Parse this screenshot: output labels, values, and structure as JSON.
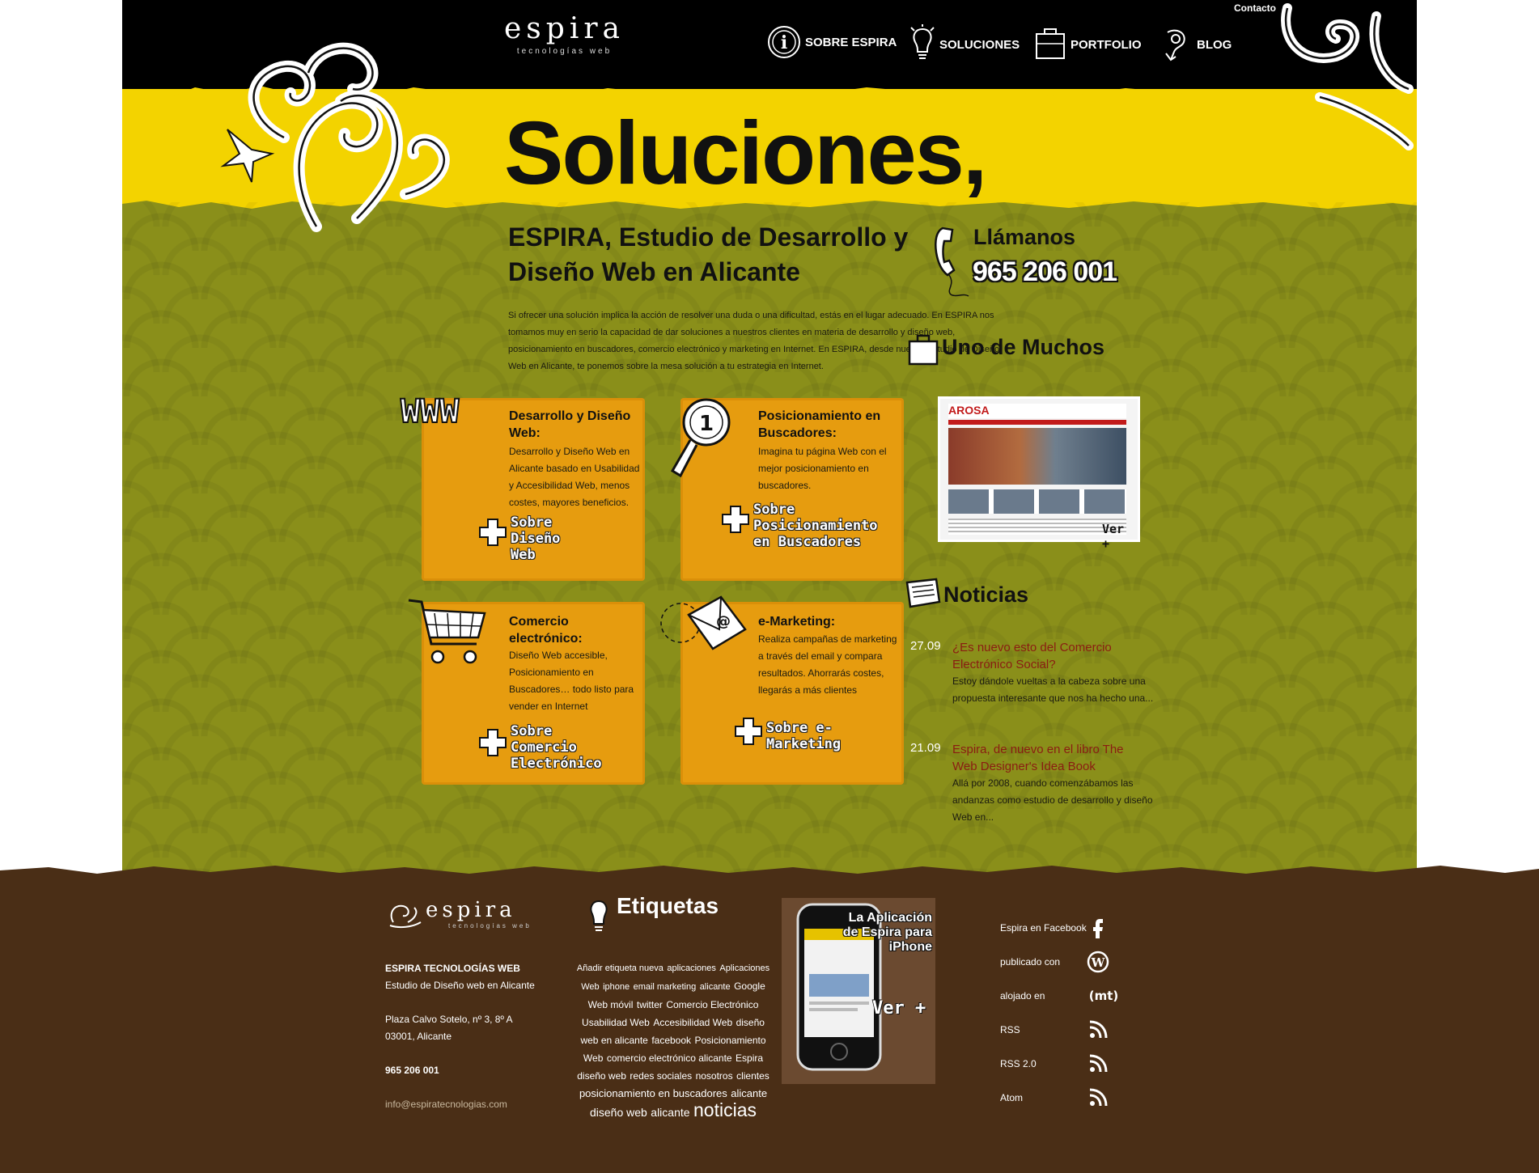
{
  "header": {
    "logo_name": "espira",
    "logo_tag": "tecnologías web",
    "contact_link": "Contacto",
    "nav": [
      {
        "label": "SOBRE ESPIRA",
        "icon": "info-icon"
      },
      {
        "label": "SOLUCIONES",
        "icon": "lightbulb-icon"
      },
      {
        "label": "PORTFOLIO",
        "icon": "briefcase-icon"
      },
      {
        "label": "BLOG",
        "icon": "megaphone-icon"
      }
    ]
  },
  "hero": {
    "title": "Soluciones,"
  },
  "intro": {
    "title_part1": "ESPIRA,",
    "title_part2": " Estudio de ",
    "title_part3": "Desarrollo y Diseño Web",
    "title_part4": " en Alicante",
    "text": "Si ofrecer una solución implica la acción de resolver una duda o una dificultad, estás en el lugar adecuado. En ESPIRA nos tomamos muy en serio la capacidad de dar soluciones a nuestros clientes en materia de desarrollo y diseño web, posicionamiento en buscadores, comercio electrónico y marketing en Internet. En ESPIRA, desde nuestro estudio de Diseño Web en Alicante, te ponemos sobre la mesa solución a tu estrategia en Internet."
  },
  "services": [
    {
      "title": "Desarrollo y Diseño Web:",
      "desc": "Desarrollo y Diseño Web en Alicante basado en Usabilidad y Accesibilidad Web, menos costes, mayores beneficios.",
      "more": "Sobre Diseño Web",
      "badge": "WWW",
      "icon": "www-icon"
    },
    {
      "title": "Posicionamiento en Buscadores:",
      "desc": "Imagina tu página Web con el mejor posicionamiento en buscadores.",
      "more": "Sobre Posicionamiento en Buscadores",
      "icon": "magnifier-icon"
    },
    {
      "title": "Comercio electrónico:",
      "desc": "Diseño Web accesible, Posicionamiento en Buscadores… todo listo para vender en Internet",
      "more": "Sobre Comercio Electrónico",
      "icon": "shopping-cart-icon"
    },
    {
      "title": "e-Marketing:",
      "desc": "Realiza campañas de marketing a través del email y compara resultados. Ahorrarás costes, llegarás a más clientes",
      "more": "Sobre e-Marketing",
      "icon": "envelope-icon"
    }
  ],
  "sidebar": {
    "call_heading": "Llámanos",
    "phone": "965 206 001",
    "portfolio_heading": "Uno de Muchos",
    "portfolio_site": "AROSA",
    "portfolio_more": "Ver +",
    "news_heading": "Noticias",
    "news": [
      {
        "date": "27.09",
        "title": "¿Es nuevo esto del Comercio Electrónico Social?",
        "excerpt": "Estoy dándole vueltas a la cabeza sobre una propuesta interesante que nos ha hecho una..."
      },
      {
        "date": "21.09",
        "title": "Espira, de nuevo en el libro The Web Designer's Idea Book",
        "excerpt": "Allá por 2008, cuando comenzábamos las andanzas como estudio de desarrollo y diseño Web en..."
      }
    ]
  },
  "footer": {
    "logo_name": "espira",
    "logo_tag": "tecnologías web",
    "company": "ESPIRA TECNOLOGÍAS WEB",
    "tagline": "Estudio de Diseño web en Alicante",
    "address1": "Plaza Calvo Sotelo, nº 3, 8º A",
    "address2": "03001, Alicante",
    "phone": "965 206 001",
    "email": "info@espiratecnologias.com",
    "tags_heading": "Etiquetas",
    "tags": [
      {
        "t": "Añadir etiqueta nueva",
        "s": 11
      },
      {
        "t": "aplicaciones",
        "s": 11
      },
      {
        "t": "Aplicaciones Web",
        "s": 11
      },
      {
        "t": "iphone",
        "s": 11
      },
      {
        "t": "email marketing",
        "s": 11
      },
      {
        "t": "alicante",
        "s": 11
      },
      {
        "t": "Google",
        "s": 12
      },
      {
        "t": "Web móvil",
        "s": 12
      },
      {
        "t": "twitter",
        "s": 12
      },
      {
        "t": "Comercio Electrónico",
        "s": 12
      },
      {
        "t": "Usabilidad Web",
        "s": 12
      },
      {
        "t": "Accesibilidad Web",
        "s": 12
      },
      {
        "t": "diseño web en alicante",
        "s": 12
      },
      {
        "t": "facebook",
        "s": 12
      },
      {
        "t": "Posicionamiento Web",
        "s": 12
      },
      {
        "t": "comercio electrónico alicante",
        "s": 12
      },
      {
        "t": "Espira",
        "s": 12
      },
      {
        "t": "diseño web",
        "s": 12
      },
      {
        "t": "redes sociales",
        "s": 12
      },
      {
        "t": "nosotros",
        "s": 12
      },
      {
        "t": "clientes",
        "s": 12
      },
      {
        "t": "posicionamiento en buscadores",
        "s": 13
      },
      {
        "t": "alicante",
        "s": 13
      },
      {
        "t": "diseño web",
        "s": 14
      },
      {
        "t": "alicante",
        "s": 14
      },
      {
        "t": "noticias",
        "s": 23
      }
    ],
    "iphone_title": "La Aplicación de Espira para iPhone",
    "iphone_more": "Ver +",
    "social": [
      {
        "label": "Espira en Facebook",
        "icon": "facebook-icon"
      },
      {
        "label": "publicado con",
        "icon": "wordpress-icon"
      },
      {
        "label": "alojado en",
        "icon": "mediatemple-icon"
      },
      {
        "label": "RSS",
        "icon": "rss-icon"
      },
      {
        "label": "RSS 2.0",
        "icon": "rss-icon"
      },
      {
        "label": "Atom",
        "icon": "rss-icon"
      }
    ]
  },
  "colors": {
    "yellow": "#f3d300",
    "olive": "#8a8f1a",
    "orange": "#e69c0f",
    "brown": "#4a2e16",
    "link_red": "#8a1c12"
  }
}
